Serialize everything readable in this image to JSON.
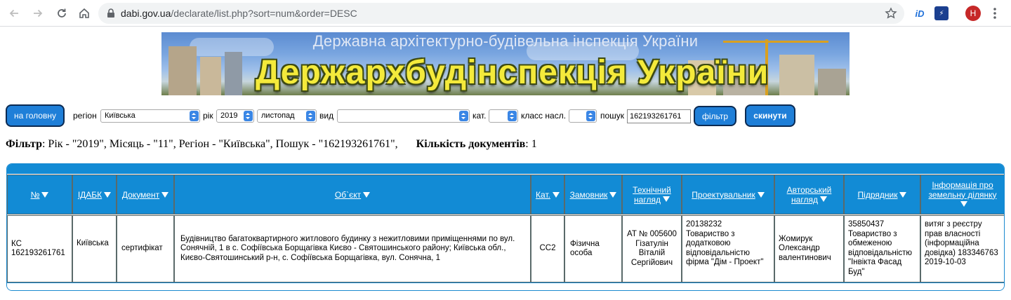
{
  "browser": {
    "url_host": "dabi.gov.ua",
    "url_path": "/declarate/list.php?sort=num&order=DESC",
    "profile_initial": "H",
    "ext1_label": "iD",
    "ext2_label": "⚡"
  },
  "banner": {
    "subtitle": "Державна архітектурно-будівельна інспекція України",
    "title": "Держархбудінспекція України"
  },
  "filters": {
    "home_button": "на головну",
    "region_label": "регіон",
    "region_value": "Київська",
    "year_label": "рік",
    "year_value": "2019",
    "month_value": "листопад",
    "type_label": "вид",
    "type_value": "",
    "category_label": "кат.",
    "category_value": "",
    "class_label": "класс насл.",
    "class_value": "",
    "search_label": "пошук",
    "search_value": "162193261761",
    "filter_button": "фільтр",
    "reset_button": "скинути"
  },
  "summary": {
    "filter_label": "Фільтр",
    "filter_text": ": Рік - \"2019\", Місяць - \"11\", Регіон - \"Київська\", Пошук - \"162193261761\",",
    "count_label": "Кількість документів",
    "count_text": ": 1"
  },
  "table": {
    "headers": {
      "num": "№",
      "idabk": "ІДАБК",
      "doc": "Документ",
      "object": "Об`єкт",
      "cat": "Кат.",
      "customer": "Замовник",
      "tech": "Технічний нагляд",
      "designer": "Проектувальник",
      "author": "Авторський нагляд",
      "contractor": "Підрядник",
      "land": "Інформація про земельну ділянку"
    },
    "row": {
      "num": "КС\n162193261761",
      "idabk": "Київська",
      "doc": "сертифікат",
      "object": "Будівництво багатоквартирного житлового будинку з нежитловими приміщеннями по вул. Сонячній, 1 в с. Софіївська Борщагівка Києво - Святошинського району; Київська обл., Києво-Святошинський р-н, с. Софіївська Борщагівка, вул. Сонячна, 1",
      "cat": "СС2",
      "customer": "Фізична\nособа",
      "tech": "АТ № 005600\nГізатулін\nВіталій\nСергійович",
      "designer": "20138232\nТовариство з додатковою відповідальністю фірма \"Дім - Проект\"",
      "author": "Жомирук\nОлександр\nвалентинович",
      "contractor": "35850437\nТовариство з обмеженою відповідальністю \"Інвікта Фасад Буд\"",
      "land": "витяг з реєстру прав власності (інформаційна довідка) 183346763 2019-10-03"
    }
  },
  "colors": {
    "header_blue": "#128bd5",
    "button_blue": "#1f7fd8",
    "banner_title_yellow": "#f4ea3b"
  }
}
